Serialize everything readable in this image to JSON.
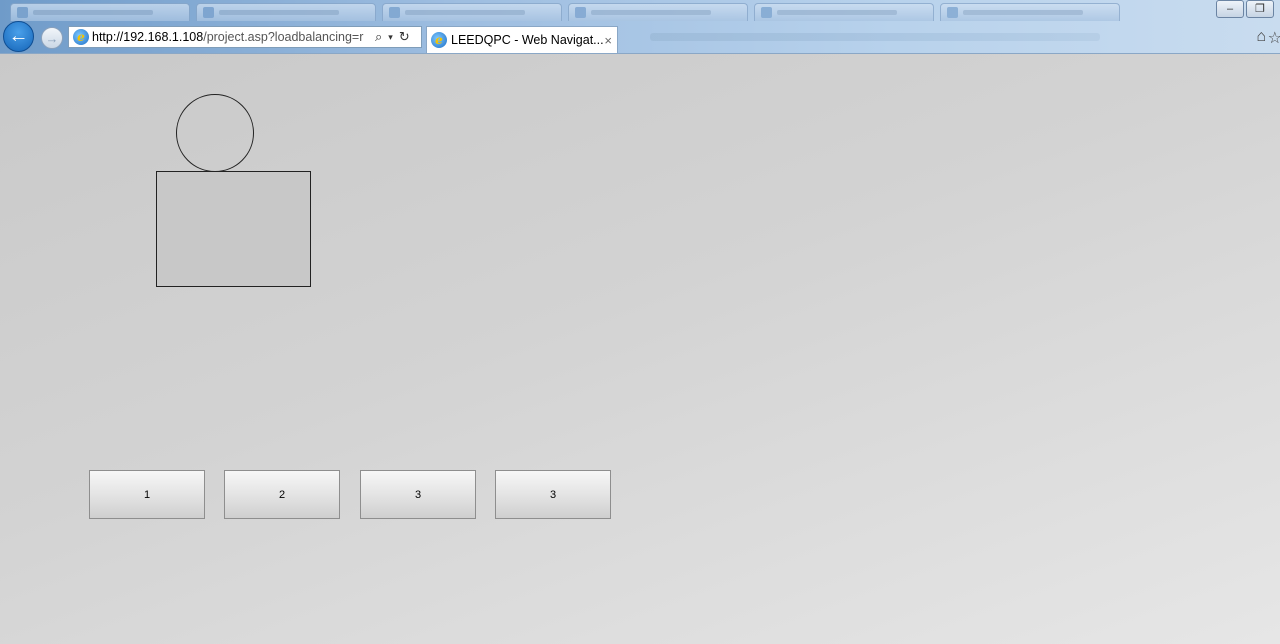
{
  "browser": {
    "url_host": "http://192.168.1.108",
    "url_path": "/project.asp?loadbalancing=r",
    "tab_title": "LEEDQPC - Web Navigat...",
    "close_glyph": "×"
  },
  "page": {
    "buttons": [
      {
        "label": "1"
      },
      {
        "label": "2"
      },
      {
        "label": "3"
      },
      {
        "label": "3"
      }
    ]
  },
  "colors": {
    "page_background": "#cfcfcf",
    "shape_stroke": "#222222",
    "rect_fill": "#c8c8c8",
    "address_bar_bg": "#ffffff"
  },
  "icons": [
    "back-icon",
    "forward-icon",
    "ie-logo-icon",
    "search-icon",
    "dropdown-icon",
    "refresh-icon",
    "tab-close-icon",
    "home-icon",
    "favorites-icon",
    "minimize-icon",
    "restore-icon"
  ]
}
